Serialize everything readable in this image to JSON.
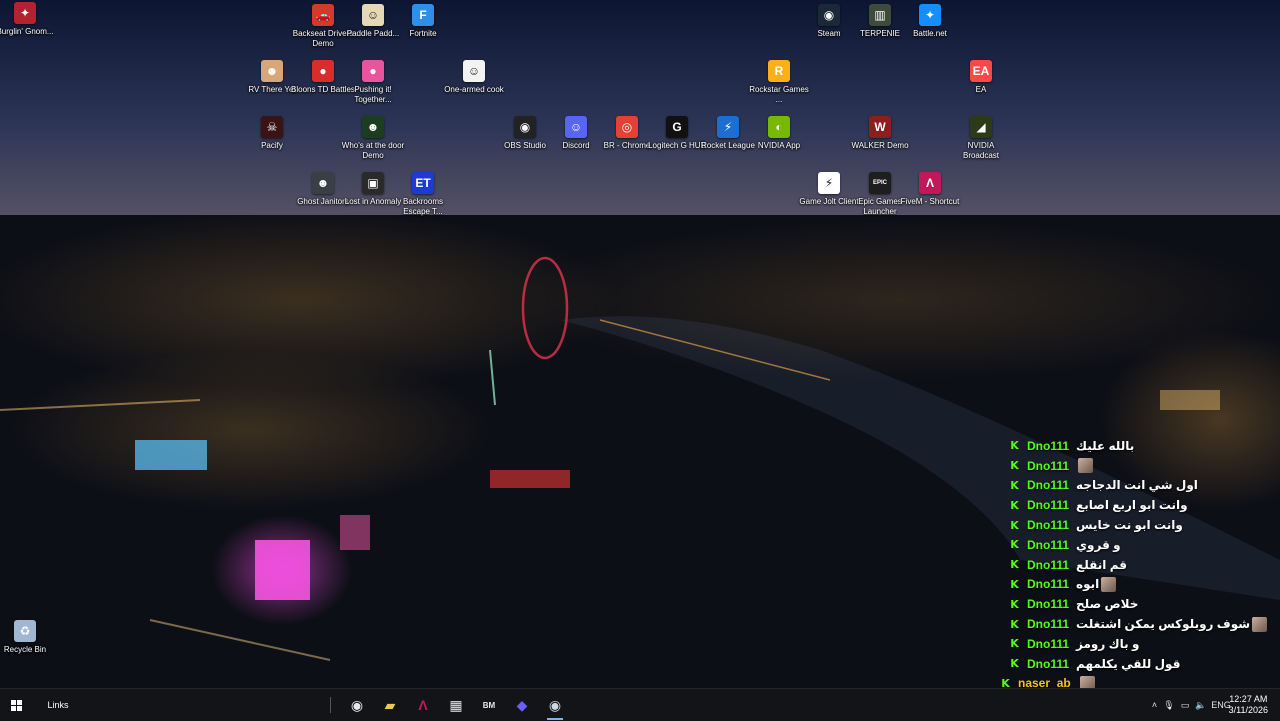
{
  "desktop_icons": [
    {
      "label": "Burglin' Gnom...",
      "icon": "burglin-gnomes-icon",
      "color": "#b2232f",
      "glyph": "✦"
    },
    {
      "label": "Backseat Drivers Demo",
      "icon": "backseat-drivers-icon",
      "color": "#d23a2a",
      "glyph": "🚗"
    },
    {
      "label": "Paddle Padd...",
      "icon": "paddle-paddle-icon",
      "color": "#e4d9b4",
      "glyph": "☺"
    },
    {
      "label": "Fortnite",
      "icon": "fortnite-icon",
      "color": "#2f8fe8",
      "glyph": "F"
    },
    {
      "label": "RV There Yet",
      "icon": "rv-there-yet-icon",
      "color": "#d7a77a",
      "glyph": "☻"
    },
    {
      "label": "Bloons TD Battles",
      "icon": "bloons-td-battles-icon",
      "color": "#d82d2d",
      "glyph": "●"
    },
    {
      "label": "Pushing it! Together...",
      "icon": "pushing-it-together-icon",
      "color": "#e8559c",
      "glyph": "●"
    },
    {
      "label": "One-armed cook",
      "icon": "one-armed-cook-icon",
      "color": "#f3f3f3",
      "glyph": "☺"
    },
    {
      "label": "Pacify",
      "icon": "pacify-icon",
      "color": "#3a1414",
      "glyph": "☠"
    },
    {
      "label": "Who's at the door Demo",
      "icon": "whos-at-the-door-icon",
      "color": "#1d3d21",
      "glyph": "☻"
    },
    {
      "label": "OBS Studio",
      "icon": "obs-studio-icon",
      "color": "#222222",
      "glyph": "◉"
    },
    {
      "label": "Discord",
      "icon": "discord-icon",
      "color": "#5865f2",
      "glyph": "☺"
    },
    {
      "label": "BR - Chrome",
      "icon": "chrome-icon",
      "color": "#e34133",
      "glyph": "◎"
    },
    {
      "label": "Logitech G HUB",
      "icon": "logitech-g-hub-icon",
      "color": "#111111",
      "glyph": "G"
    },
    {
      "label": "Rocket League",
      "icon": "rocket-league-icon",
      "color": "#1c6fd1",
      "glyph": "⚡"
    },
    {
      "label": "NVIDIA App",
      "icon": "nvidia-app-icon",
      "color": "#76b900",
      "glyph": "◐"
    },
    {
      "label": "Ghost Janitors",
      "icon": "ghost-janitors-icon",
      "color": "#3a3f46",
      "glyph": "☻"
    },
    {
      "label": "Lost in Anomaly",
      "icon": "lost-in-anomaly-icon",
      "color": "#2a2a2a",
      "glyph": "▣"
    },
    {
      "label": "Backrooms Escape T...",
      "icon": "backrooms-escape-icon",
      "color": "#1a3bd6",
      "glyph": "ET"
    },
    {
      "label": "Steam",
      "icon": "steam-icon",
      "color": "#1b2838",
      "glyph": "◉"
    },
    {
      "label": "TERPENIE",
      "icon": "terpenie-icon",
      "color": "#3e4a3c",
      "glyph": "▥"
    },
    {
      "label": "Battle.net",
      "icon": "battle-net-icon",
      "color": "#148eff",
      "glyph": "✦"
    },
    {
      "label": "Rockstar Games ...",
      "icon": "rockstar-games-icon",
      "color": "#fcaf17",
      "glyph": "R"
    },
    {
      "label": "EA",
      "icon": "ea-icon",
      "color": "#ff4747",
      "glyph": "EA"
    },
    {
      "label": "WALKER Demo",
      "icon": "walker-demo-icon",
      "color": "#8a1f1f",
      "glyph": "W"
    },
    {
      "label": "NVIDIA Broadcast",
      "icon": "nvidia-broadcast-icon",
      "color": "#2d3a17",
      "glyph": "◢"
    },
    {
      "label": "Game Jolt Client",
      "icon": "game-jolt-icon",
      "color": "#ffffff",
      "glyph": "⚡"
    },
    {
      "label": "Epic Games Launcher",
      "icon": "epic-games-icon",
      "color": "#1e1e1e",
      "glyph": "EPIC"
    },
    {
      "label": "FiveM - Shortcut",
      "icon": "fivem-icon",
      "color": "#c2185b",
      "glyph": "Λ"
    },
    {
      "label": "Recycle Bin",
      "icon": "recycle-bin-icon",
      "color": "#9fb7d0",
      "glyph": "♻"
    }
  ],
  "chat": {
    "messages": [
      {
        "user": "Dno111",
        "user_color": "#53fc18",
        "text": "بالله عليك",
        "emote": false
      },
      {
        "user": "Dno111",
        "user_color": "#53fc18",
        "text": "",
        "emote": true
      },
      {
        "user": "Dno111",
        "user_color": "#53fc18",
        "text": "اول شي انت الدجاجه",
        "emote": false
      },
      {
        "user": "Dno111",
        "user_color": "#53fc18",
        "text": "وانت ابو اربع اصابع",
        "emote": false
      },
      {
        "user": "Dno111",
        "user_color": "#53fc18",
        "text": "وانت ابو نت خايس",
        "emote": false
      },
      {
        "user": "Dno111",
        "user_color": "#53fc18",
        "text": "و قروي",
        "emote": false
      },
      {
        "user": "Dno111",
        "user_color": "#53fc18",
        "text": "قم انقلع",
        "emote": false
      },
      {
        "user": "Dno111",
        "user_color": "#53fc18",
        "text": "ابوه",
        "emote": true
      },
      {
        "user": "Dno111",
        "user_color": "#53fc18",
        "text": "خلاص صلح",
        "emote": false
      },
      {
        "user": "Dno111",
        "user_color": "#53fc18",
        "text": "شوف روبلوكس يمكن اشتغلت",
        "emote": true
      },
      {
        "user": "Dno111",
        "user_color": "#53fc18",
        "text": "و باك رومز",
        "emote": false
      },
      {
        "user": "Dno111",
        "user_color": "#53fc18",
        "text": "قول للقي يكلمهم",
        "emote": false
      },
      {
        "user": "naser_ab",
        "user_color": "#f0c419",
        "text": "",
        "emote": true
      },
      {
        "user": "naser_ab",
        "user_color": "#f0c419",
        "text": "",
        "emote": true
      }
    ]
  },
  "taskbar": {
    "toolbar_label": "Links",
    "pinned": [
      {
        "name": "obs-taskbar-icon",
        "color": "#e8e8e8",
        "glyph": "◉"
      },
      {
        "name": "file-explorer-taskbar-icon",
        "color": "#f2c94c",
        "glyph": "▰"
      },
      {
        "name": "fivem-taskbar-icon",
        "color": "#c2185b",
        "glyph": "Λ"
      },
      {
        "name": "store-taskbar-icon",
        "color": "#e8e8e8",
        "glyph": "▦"
      },
      {
        "name": "app-bm-taskbar-icon",
        "color": "#e8e8e8",
        "glyph": "BM"
      },
      {
        "name": "linear-taskbar-icon",
        "color": "#6b5cff",
        "glyph": "◆"
      },
      {
        "name": "steam-taskbar-icon",
        "color": "#cfd8e3",
        "glyph": "◉"
      }
    ],
    "language": "ENG",
    "time": "12:27 AM",
    "date": "3/11/2026"
  }
}
